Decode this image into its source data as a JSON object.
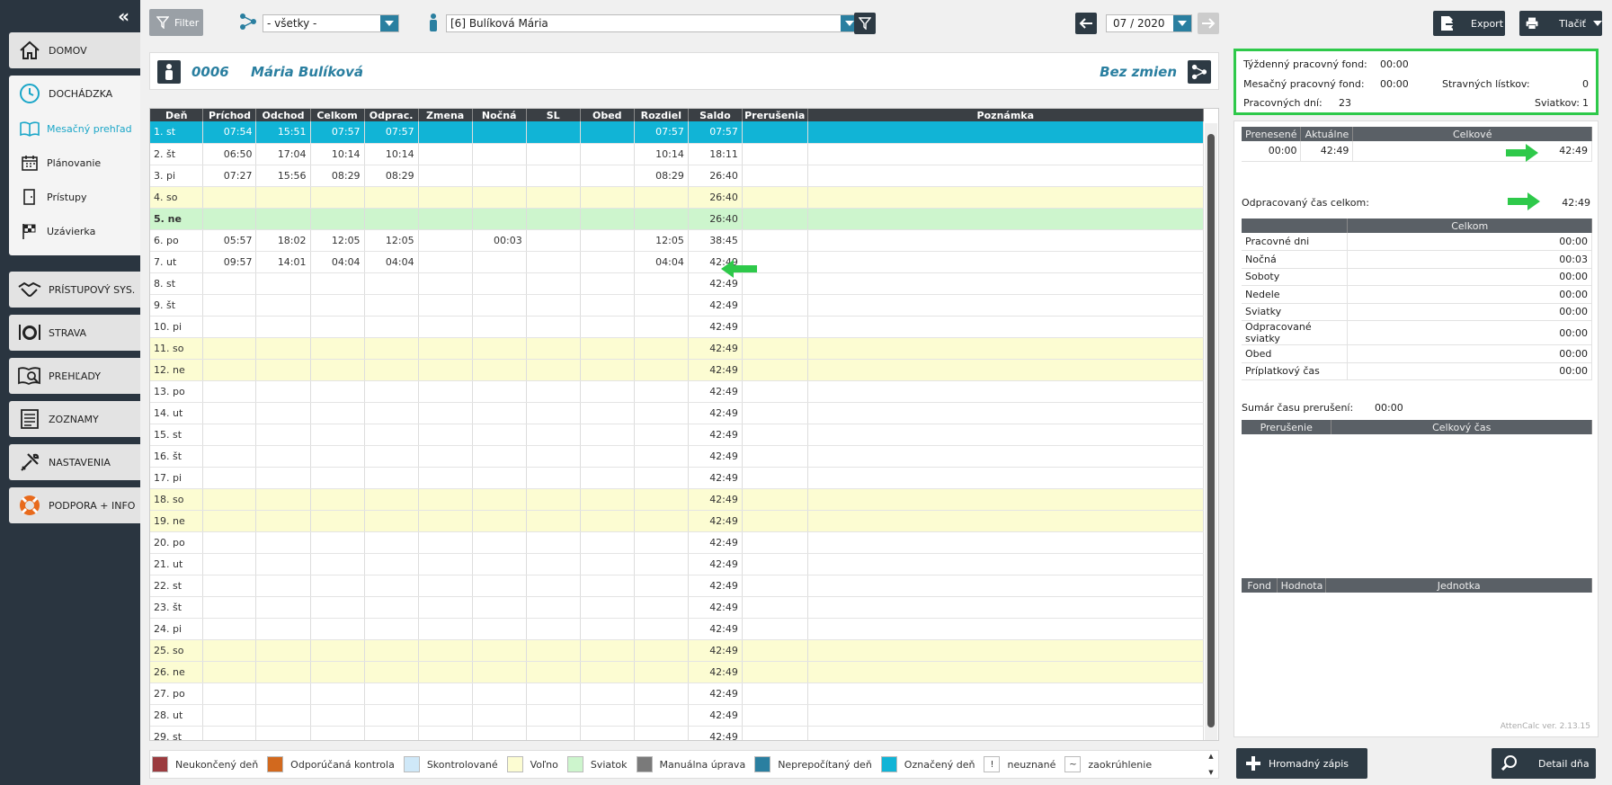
{
  "sidebar": {
    "collapse_glyph": "«",
    "home": "DOMOV",
    "attendance": "DOCHÁDZKA",
    "sub_items": [
      "Mesačný prehľad",
      "Plánovanie",
      "Prístupy",
      "Uzávierka"
    ],
    "access": "PRÍSTUPOVÝ SYS.",
    "food": "STRAVA",
    "overviews": "PREHĽADY",
    "lists": "ZOZNAMY",
    "settings": "NASTAVENIA",
    "support": "PODPORA + INFO"
  },
  "topbar": {
    "filter_label": "Filter",
    "group_select": "- všetky -",
    "employee_select": "[6] Bulíková Mária",
    "period": "07 / 2020",
    "export_label": "Export",
    "print_label": "Tlačiť"
  },
  "employee": {
    "code": "0006",
    "name": "Mária Bulíková",
    "shift_status": "Bez zmien"
  },
  "table": {
    "headers": [
      "Deň",
      "Príchod",
      "Odchod",
      "Celkom",
      "Odprac.",
      "Zmena",
      "Nočná",
      "SL",
      "Obed",
      "Rozdiel",
      "Saldo",
      "Prerušenia",
      "Poznámka"
    ],
    "rows": [
      {
        "day": "1. st",
        "in": "07:54",
        "out": "15:51",
        "total": "07:57",
        "worked": "07:57",
        "night": "",
        "diff": "07:57",
        "saldo": "07:57",
        "type": "selected"
      },
      {
        "day": "2. št",
        "in": "06:50",
        "out": "17:04",
        "total": "10:14",
        "worked": "10:14",
        "night": "",
        "diff": "10:14",
        "saldo": "18:11",
        "type": "normal"
      },
      {
        "day": "3. pi",
        "in": "07:27",
        "out": "15:56",
        "total": "08:29",
        "worked": "08:29",
        "night": "",
        "diff": "08:29",
        "saldo": "26:40",
        "type": "normal"
      },
      {
        "day": "4. so",
        "in": "",
        "out": "",
        "total": "",
        "worked": "",
        "night": "",
        "diff": "",
        "saldo": "26:40",
        "type": "weekend"
      },
      {
        "day": "5. ne",
        "in": "",
        "out": "",
        "total": "",
        "worked": "",
        "night": "",
        "diff": "",
        "saldo": "26:40",
        "type": "holiday"
      },
      {
        "day": "6. po",
        "in": "05:57",
        "out": "18:02",
        "total": "12:05",
        "worked": "12:05",
        "night": "00:03",
        "diff": "12:05",
        "saldo": "38:45",
        "type": "normal"
      },
      {
        "day": "7. ut",
        "in": "09:57",
        "out": "14:01",
        "total": "04:04",
        "worked": "04:04",
        "night": "",
        "diff": "04:04",
        "saldo": "42:49",
        "type": "normal"
      },
      {
        "day": "8. st",
        "in": "",
        "out": "",
        "total": "",
        "worked": "",
        "night": "",
        "diff": "",
        "saldo": "42:49",
        "type": "normal"
      },
      {
        "day": "9. št",
        "in": "",
        "out": "",
        "total": "",
        "worked": "",
        "night": "",
        "diff": "",
        "saldo": "42:49",
        "type": "normal"
      },
      {
        "day": "10. pi",
        "in": "",
        "out": "",
        "total": "",
        "worked": "",
        "night": "",
        "diff": "",
        "saldo": "42:49",
        "type": "normal"
      },
      {
        "day": "11. so",
        "in": "",
        "out": "",
        "total": "",
        "worked": "",
        "night": "",
        "diff": "",
        "saldo": "42:49",
        "type": "weekend"
      },
      {
        "day": "12. ne",
        "in": "",
        "out": "",
        "total": "",
        "worked": "",
        "night": "",
        "diff": "",
        "saldo": "42:49",
        "type": "weekend"
      },
      {
        "day": "13. po",
        "in": "",
        "out": "",
        "total": "",
        "worked": "",
        "night": "",
        "diff": "",
        "saldo": "42:49",
        "type": "normal"
      },
      {
        "day": "14. ut",
        "in": "",
        "out": "",
        "total": "",
        "worked": "",
        "night": "",
        "diff": "",
        "saldo": "42:49",
        "type": "normal"
      },
      {
        "day": "15. st",
        "in": "",
        "out": "",
        "total": "",
        "worked": "",
        "night": "",
        "diff": "",
        "saldo": "42:49",
        "type": "normal"
      },
      {
        "day": "16. št",
        "in": "",
        "out": "",
        "total": "",
        "worked": "",
        "night": "",
        "diff": "",
        "saldo": "42:49",
        "type": "normal"
      },
      {
        "day": "17. pi",
        "in": "",
        "out": "",
        "total": "",
        "worked": "",
        "night": "",
        "diff": "",
        "saldo": "42:49",
        "type": "normal"
      },
      {
        "day": "18. so",
        "in": "",
        "out": "",
        "total": "",
        "worked": "",
        "night": "",
        "diff": "",
        "saldo": "42:49",
        "type": "weekend"
      },
      {
        "day": "19. ne",
        "in": "",
        "out": "",
        "total": "",
        "worked": "",
        "night": "",
        "diff": "",
        "saldo": "42:49",
        "type": "weekend"
      },
      {
        "day": "20. po",
        "in": "",
        "out": "",
        "total": "",
        "worked": "",
        "night": "",
        "diff": "",
        "saldo": "42:49",
        "type": "normal"
      },
      {
        "day": "21. ut",
        "in": "",
        "out": "",
        "total": "",
        "worked": "",
        "night": "",
        "diff": "",
        "saldo": "42:49",
        "type": "normal"
      },
      {
        "day": "22. st",
        "in": "",
        "out": "",
        "total": "",
        "worked": "",
        "night": "",
        "diff": "",
        "saldo": "42:49",
        "type": "normal"
      },
      {
        "day": "23. št",
        "in": "",
        "out": "",
        "total": "",
        "worked": "",
        "night": "",
        "diff": "",
        "saldo": "42:49",
        "type": "normal"
      },
      {
        "day": "24. pi",
        "in": "",
        "out": "",
        "total": "",
        "worked": "",
        "night": "",
        "diff": "",
        "saldo": "42:49",
        "type": "normal"
      },
      {
        "day": "25. so",
        "in": "",
        "out": "",
        "total": "",
        "worked": "",
        "night": "",
        "diff": "",
        "saldo": "42:49",
        "type": "weekend"
      },
      {
        "day": "26. ne",
        "in": "",
        "out": "",
        "total": "",
        "worked": "",
        "night": "",
        "diff": "",
        "saldo": "42:49",
        "type": "weekend"
      },
      {
        "day": "27. po",
        "in": "",
        "out": "",
        "total": "",
        "worked": "",
        "night": "",
        "diff": "",
        "saldo": "42:49",
        "type": "normal"
      },
      {
        "day": "28. ut",
        "in": "",
        "out": "",
        "total": "",
        "worked": "",
        "night": "",
        "diff": "",
        "saldo": "42:49",
        "type": "normal"
      },
      {
        "day": "29. st",
        "in": "",
        "out": "",
        "total": "",
        "worked": "",
        "night": "",
        "diff": "",
        "saldo": "42:49",
        "type": "normal"
      }
    ]
  },
  "legend": [
    {
      "label": "Neukončený deň",
      "color": "#9b3b3f"
    },
    {
      "label": "Odporúčaná kontrola",
      "color": "#d2691e"
    },
    {
      "label": "Skontrolované",
      "color": "#cfe8f8"
    },
    {
      "label": "Voľno",
      "color": "#fcfcd2"
    },
    {
      "label": "Sviatok",
      "color": "#cdf5cd"
    },
    {
      "label": "Manuálna úprava",
      "color": "#7a7a7a"
    },
    {
      "label": "Neprepočítaný deň",
      "color": "#2a7fa0"
    },
    {
      "label": "Označený deň",
      "color": "#11b4d6"
    }
  ],
  "legend_symbols": [
    {
      "symbol": "!",
      "label": "neuznané"
    },
    {
      "symbol": "~",
      "label": "zaokrúhlenie"
    }
  ],
  "summary": {
    "weekly_fund_label": "Týždenný pracovný fond:",
    "weekly_fund_value": "00:00",
    "monthly_fund_label": "Mesačný pracovný fond:",
    "monthly_fund_value": "00:00",
    "meal_tickets_label": "Stravných lístkov:",
    "meal_tickets_value": "0",
    "work_days_label": "Pracovných dní:",
    "work_days_value": "23",
    "holidays_label": "Sviatkov:",
    "holidays_value": "1"
  },
  "balance": {
    "headers": [
      "Prenesené",
      "Aktuálne",
      "Celkové"
    ],
    "values": [
      "00:00",
      "42:49",
      "42:49"
    ]
  },
  "worked_total": {
    "label": "Odpracovaný čas celkom:",
    "value": "42:49"
  },
  "categories": {
    "header": "Celkom",
    "rows": [
      {
        "label": "Pracovné dni",
        "value": "00:00"
      },
      {
        "label": "Nočná",
        "value": "00:03"
      },
      {
        "label": "Soboty",
        "value": "00:00"
      },
      {
        "label": "Nedele",
        "value": "00:00"
      },
      {
        "label": "Sviatky",
        "value": "00:00"
      },
      {
        "label": "Odpracované sviatky",
        "value": "00:00"
      },
      {
        "label": "Obed",
        "value": "00:00"
      },
      {
        "label": "Príplatkový čas",
        "value": "00:00"
      }
    ]
  },
  "interruptions": {
    "label": "Sumár času prerušení:",
    "value": "00:00",
    "headers": [
      "Prerušenie",
      "Celkový čas"
    ]
  },
  "fund_table": {
    "headers": [
      "Fond",
      "Hodnota",
      "Jednotka"
    ]
  },
  "version": "AttenCalc ver. 2.13.15",
  "buttons": {
    "bulk_entry": "Hromadný zápis",
    "day_detail": "Detail dňa"
  },
  "colors": {
    "accent": "#11b4d6",
    "dark": "#2d3a44",
    "highlight_green": "#2ec94a"
  }
}
